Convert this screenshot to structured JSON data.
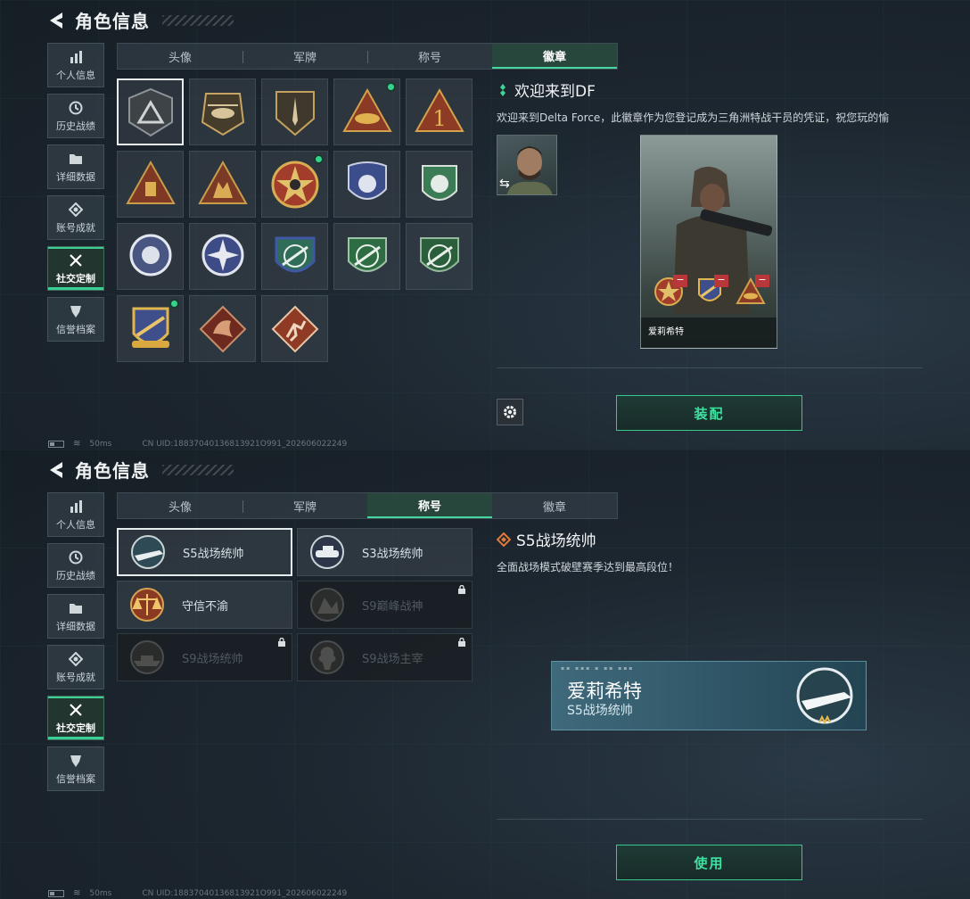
{
  "top": {
    "header": {
      "title": "角色信息"
    },
    "sidebar": [
      {
        "label": "个人信息",
        "icon": "bar-chart-icon"
      },
      {
        "label": "历史战绩",
        "icon": "clock-icon"
      },
      {
        "label": "详细数据",
        "icon": "folder-icon"
      },
      {
        "label": "账号成就",
        "icon": "achievement-icon"
      },
      {
        "label": "社交定制",
        "icon": "tools-icon",
        "active": true
      },
      {
        "label": "信誉档案",
        "icon": "shield-icon"
      }
    ],
    "tabs": [
      {
        "label": "头像"
      },
      {
        "label": "军牌"
      },
      {
        "label": "称号"
      },
      {
        "label": "徽章",
        "active": true
      }
    ],
    "detail": {
      "title": "欢迎来到DF",
      "description": "欢迎来到Delta Force，此徽章作为您登记成为三角洲特战干员的凭证，祝您玩的愉",
      "card_name": "爱莉希特",
      "button": "装配"
    },
    "status": {
      "ping": "50ms",
      "uid": "CN UID:18837040136813921O991_202606022249"
    }
  },
  "bottom": {
    "header": {
      "title": "角色信息"
    },
    "sidebar": [
      {
        "label": "个人信息"
      },
      {
        "label": "历史战绩"
      },
      {
        "label": "详细数据"
      },
      {
        "label": "账号成就"
      },
      {
        "label": "社交定制",
        "active": true
      },
      {
        "label": "信誉档案"
      }
    ],
    "tabs": [
      {
        "label": "头像"
      },
      {
        "label": "军牌"
      },
      {
        "label": "称号",
        "active": true
      },
      {
        "label": "徽章"
      }
    ],
    "titles": [
      {
        "label": "S5战场统帅",
        "selected": true,
        "locked": false
      },
      {
        "label": "S3战场统帅",
        "locked": false
      },
      {
        "label": "守信不渝",
        "locked": false
      },
      {
        "label": "S9巅峰战神",
        "locked": true
      },
      {
        "label": "S9战场统帅",
        "locked": true
      },
      {
        "label": "S9战场主宰",
        "locked": true
      }
    ],
    "detail": {
      "title": "S5战场统帅",
      "description": "全面战场模式破壁赛季达到最高段位！",
      "namecard_name": "爱莉希特",
      "namecard_title": "S5战场统帅",
      "button": "使用"
    },
    "status": {
      "ping": "50ms",
      "uid": "CN UID:18837040136813921O991_202606022249"
    }
  },
  "colors": {
    "accent": "#3fe0a0",
    "dot": "#35d48d",
    "remove": "#b8373a"
  }
}
